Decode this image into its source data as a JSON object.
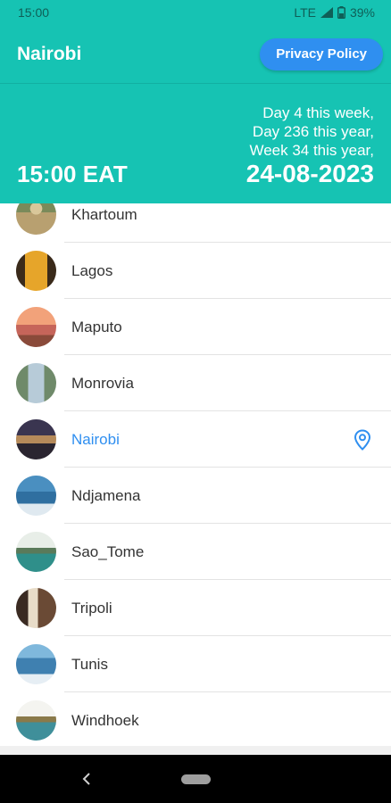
{
  "status_bar": {
    "time": "15:00",
    "network": "LTE",
    "battery": "39%"
  },
  "app_bar": {
    "title": "Nairobi",
    "privacy_label": "Privacy Policy"
  },
  "info": {
    "time": "15:00 EAT",
    "day_of_week": "Day 4 this week,",
    "day_of_year": "Day 236 this year,",
    "week_of_year": "Week 34 this year,",
    "date": "24-08-2023"
  },
  "cities": [
    {
      "name": "Khartoum",
      "selected": false
    },
    {
      "name": "Lagos",
      "selected": false
    },
    {
      "name": "Maputo",
      "selected": false
    },
    {
      "name": "Monrovia",
      "selected": false
    },
    {
      "name": "Nairobi",
      "selected": true
    },
    {
      "name": "Ndjamena",
      "selected": false
    },
    {
      "name": "Sao_Tome",
      "selected": false
    },
    {
      "name": "Tripoli",
      "selected": false
    },
    {
      "name": "Tunis",
      "selected": false
    },
    {
      "name": "Windhoek",
      "selected": false
    }
  ],
  "colors": {
    "accent": "#16c3b3",
    "button": "#2f8ff0",
    "selected_text": "#2f8ff0"
  },
  "icons": {
    "selected_marker": "location-pin-icon",
    "nav_back": "back-icon",
    "nav_home": "home-pill-icon"
  }
}
